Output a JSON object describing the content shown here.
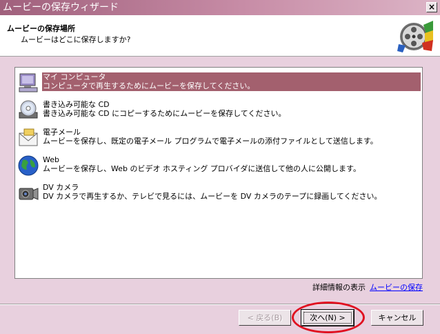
{
  "window": {
    "title": "ムービーの保存ウィザード",
    "close_label": "×"
  },
  "header": {
    "title": "ムービーの保存場所",
    "subtitle": "ムービーはどこに保存しますか?"
  },
  "items": [
    {
      "icon": "computer-icon",
      "title": "マイ コンピュータ",
      "desc": "コンピュータで再生するためにムービーを保存してください。",
      "selected": true
    },
    {
      "icon": "cd-drive-icon",
      "title": "書き込み可能な CD",
      "desc": "書き込み可能な CD にコピーするためにムービーを保存してください。",
      "selected": false
    },
    {
      "icon": "email-icon",
      "title": "電子メール",
      "desc": "ムービーを保存し、既定の電子メール プログラムで電子メールの添付ファイルとして送信します。",
      "selected": false
    },
    {
      "icon": "globe-icon",
      "title": "Web",
      "desc": "ムービーを保存し、Web のビデオ ホスティング プロバイダに送信して他の人に公開します。",
      "selected": false
    },
    {
      "icon": "camcorder-icon",
      "title": "DV カメラ",
      "desc": "DV カメラで再生するか、テレビで見るには、ムービーを DV カメラのテープに録画してください。",
      "selected": false
    }
  ],
  "more_info": {
    "label": "詳細情報の表示",
    "link": "ムービーの保存"
  },
  "buttons": {
    "back": "< 戻る(B)",
    "next": "次へ(N) >",
    "cancel": "キャンセル"
  },
  "colors": {
    "selection": "#a3606e",
    "annotation_ring": "#e01020",
    "title_gradient_start": "#a0607c"
  }
}
